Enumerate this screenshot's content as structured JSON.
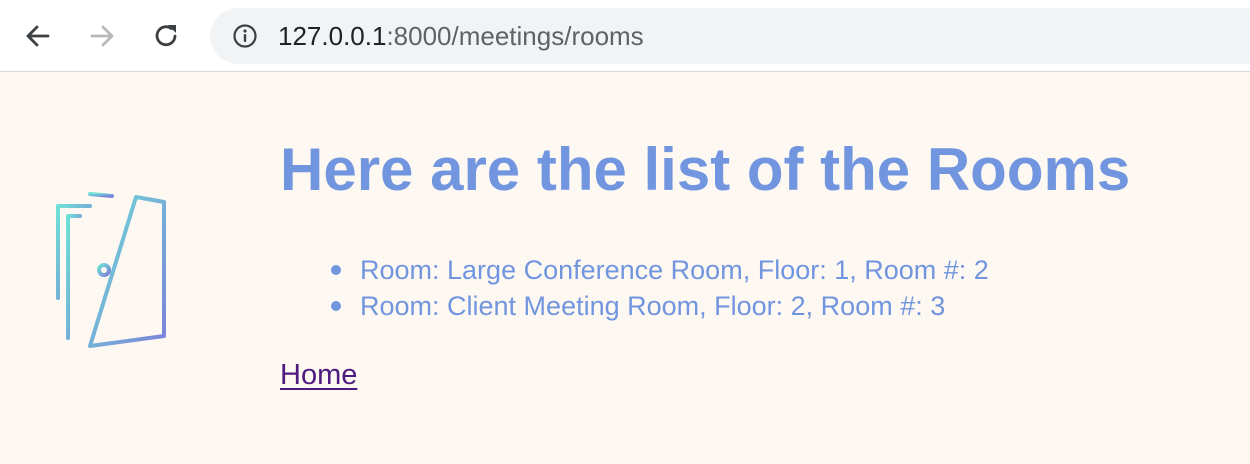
{
  "browser": {
    "url_host": "127.0.0.1",
    "url_rest": ":8000/meetings/rooms",
    "icons": {
      "back": "arrow-left-icon",
      "forward": "arrow-right-icon",
      "reload": "reload-icon",
      "info": "info-icon"
    }
  },
  "page": {
    "title": "Here are the list of the Rooms",
    "rooms": [
      "Room: Large Conference Room, Floor: 1, Room #: 2",
      "Room: Client Meeting Room, Floor: 2, Room #: 3"
    ],
    "home_link": "Home",
    "icon": "door-icon"
  },
  "colors": {
    "background": "#fdf8f1",
    "accent": "#7295df",
    "link": "#4d1a7f",
    "door_gradient_start": "#6ee0d6",
    "door_gradient_end": "#7b82d8"
  }
}
